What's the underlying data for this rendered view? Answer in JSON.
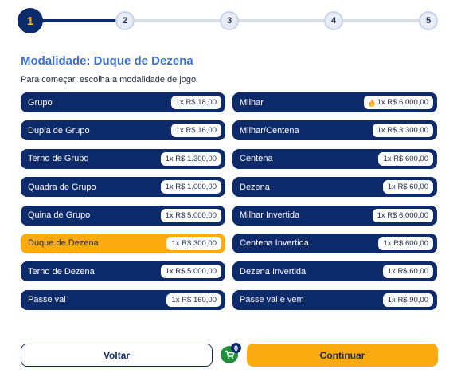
{
  "stepper": {
    "steps": [
      "1",
      "2",
      "3",
      "4",
      "5"
    ],
    "active_step": 1,
    "progress": 0.125
  },
  "header": {
    "title": "Modalidade: Duque de Dezena",
    "subtitle": "Para começar, escolha a modalidade de jogo."
  },
  "options_left": [
    {
      "label": "Grupo",
      "price": "1x R$ 18,00"
    },
    {
      "label": "Dupla de Grupo",
      "price": "1x R$ 16,00"
    },
    {
      "label": "Terno de Grupo",
      "price": "1x R$ 1.300,00"
    },
    {
      "label": "Quadra de Grupo",
      "price": "1x R$ 1.000,00"
    },
    {
      "label": "Quina de Grupo",
      "price": "1x R$ 5.000,00"
    },
    {
      "label": "Duque de Dezena",
      "price": "1x R$ 300,00",
      "selected": true
    },
    {
      "label": "Terno de Dezena",
      "price": "1x R$ 5.000,00"
    },
    {
      "label": "Passe vai",
      "price": "1x R$ 160,00"
    }
  ],
  "options_right": [
    {
      "label": "Milhar",
      "price": "1x R$ 6.000,00",
      "icon": "flame-icon"
    },
    {
      "label": "Milhar/Centena",
      "price": "1x R$ 3.300,00"
    },
    {
      "label": "Centena",
      "price": "1x R$ 600,00"
    },
    {
      "label": "Dezena",
      "price": "1x R$ 60,00"
    },
    {
      "label": "Milhar Invertida",
      "price": "1x R$ 6.000,00"
    },
    {
      "label": "Centena Invertida",
      "price": "1x R$ 600,00"
    },
    {
      "label": "Dezena Invertida",
      "price": "1x R$ 60,00"
    },
    {
      "label": "Passe vai e vem",
      "price": "1x R$ 90,00"
    }
  ],
  "footer": {
    "back_label": "Voltar",
    "next_label": "Continuar",
    "cart_icon": "cart-icon",
    "cart_count": "0"
  },
  "colors": {
    "navy": "#0d2a6b",
    "accent": "#fbab10",
    "title_blue": "#3a6fd8",
    "cart_green": "#1e8f3b"
  }
}
